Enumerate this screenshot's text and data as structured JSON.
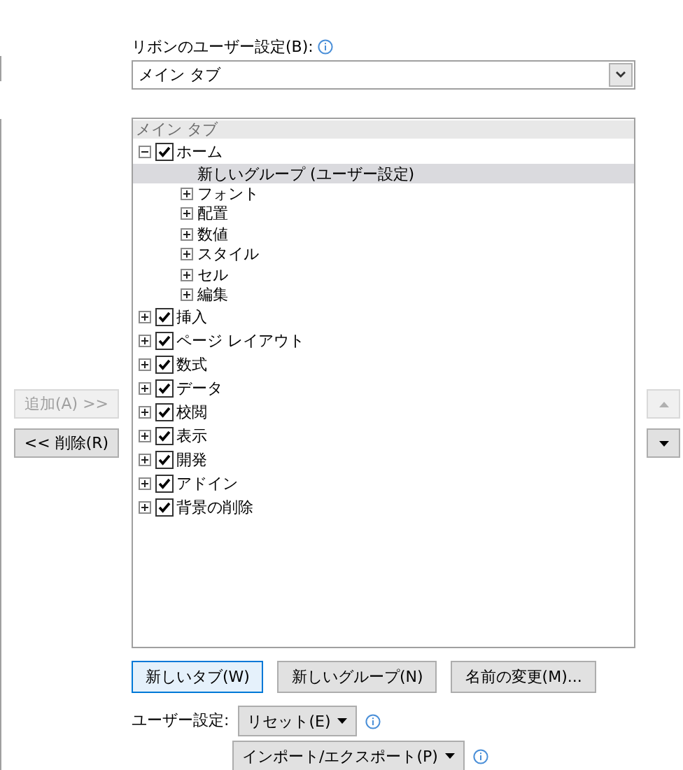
{
  "ribbon_label": "リボンのユーザー設定(B):",
  "ribbon_dropdown": {
    "value": "メイン タブ"
  },
  "add_button": {
    "label": "追加(A) >>",
    "disabled": true
  },
  "remove_button": {
    "label": "<< 削除(R)",
    "disabled": false
  },
  "move_up_button": {
    "disabled": true
  },
  "move_down_button": {
    "disabled": false
  },
  "tree": {
    "header": "メイン タブ",
    "items": [
      {
        "kind": "tab",
        "label": "ホーム",
        "expanded": true,
        "checked": true,
        "selected": false,
        "children": [
          {
            "kind": "new-group",
            "label": "新しいグループ (ユーザー設定)",
            "selected": true
          },
          {
            "kind": "group",
            "label": "フォント",
            "expanded": false,
            "selected": false
          },
          {
            "kind": "group",
            "label": "配置",
            "expanded": false,
            "selected": false
          },
          {
            "kind": "group",
            "label": "数値",
            "expanded": false,
            "selected": false
          },
          {
            "kind": "group",
            "label": "スタイル",
            "expanded": false,
            "selected": false
          },
          {
            "kind": "group",
            "label": "セル",
            "expanded": false,
            "selected": false
          },
          {
            "kind": "group",
            "label": "編集",
            "expanded": false,
            "selected": false
          }
        ]
      },
      {
        "kind": "tab",
        "label": "挿入",
        "expanded": false,
        "checked": true,
        "selected": false
      },
      {
        "kind": "tab",
        "label": "ページ レイアウト",
        "expanded": false,
        "checked": true,
        "selected": false
      },
      {
        "kind": "tab",
        "label": "数式",
        "expanded": false,
        "checked": true,
        "selected": false
      },
      {
        "kind": "tab",
        "label": "データ",
        "expanded": false,
        "checked": true,
        "selected": false
      },
      {
        "kind": "tab",
        "label": "校閲",
        "expanded": false,
        "checked": true,
        "selected": false
      },
      {
        "kind": "tab",
        "label": "表示",
        "expanded": false,
        "checked": true,
        "selected": false
      },
      {
        "kind": "tab",
        "label": "開発",
        "expanded": false,
        "checked": true,
        "selected": false
      },
      {
        "kind": "tab",
        "label": "アドイン",
        "expanded": false,
        "checked": true,
        "selected": false
      },
      {
        "kind": "tab",
        "label": "背景の削除",
        "expanded": false,
        "checked": true,
        "selected": false
      }
    ]
  },
  "action_buttons": [
    {
      "label": "新しいタブ(W)",
      "focused": true
    },
    {
      "label": "新しいグループ(N)",
      "focused": false
    },
    {
      "label": "名前の変更(M)...",
      "focused": false
    }
  ],
  "customizations_label": "ユーザー設定:",
  "reset_button": {
    "label": "リセット(E)"
  },
  "import_export_button": {
    "label": "インポート/エクスポート(P)"
  }
}
